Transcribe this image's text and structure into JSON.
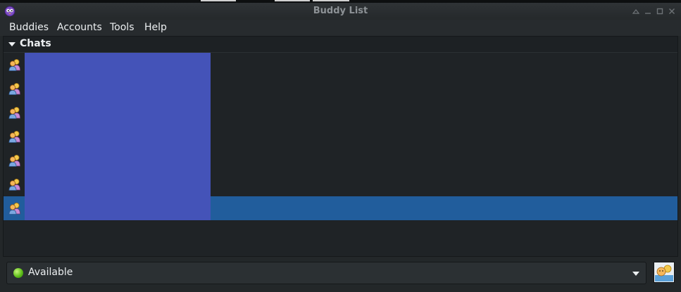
{
  "window": {
    "title": "Buddy List",
    "controls": [
      "minimize-icon",
      "maximize-icon",
      "restore-icon",
      "close-icon"
    ]
  },
  "menubar": {
    "items": [
      "Buddies",
      "Accounts",
      "Tools",
      "Help"
    ]
  },
  "buddy_list": {
    "group": {
      "label": "Chats",
      "expanded": true
    },
    "chats": [
      {
        "name": "",
        "icon": "chat-people-icon",
        "selected": false
      },
      {
        "name": "",
        "icon": "chat-people-icon",
        "selected": false
      },
      {
        "name": "",
        "icon": "chat-people-icon",
        "selected": false
      },
      {
        "name": "",
        "icon": "chat-people-icon",
        "selected": false
      },
      {
        "name": "",
        "icon": "chat-people-icon",
        "selected": false
      },
      {
        "name": "",
        "icon": "chat-people-icon",
        "selected": false
      },
      {
        "name": "",
        "icon": "chat-people-icon",
        "selected": true
      }
    ]
  },
  "status": {
    "selected": "Available",
    "icon": "available-status-icon"
  },
  "colors": {
    "background": "#1f2326",
    "selection": "#215d9c",
    "name_redaction": "#4453b8",
    "text": "#eceff1",
    "title_text": "#8d9296"
  }
}
